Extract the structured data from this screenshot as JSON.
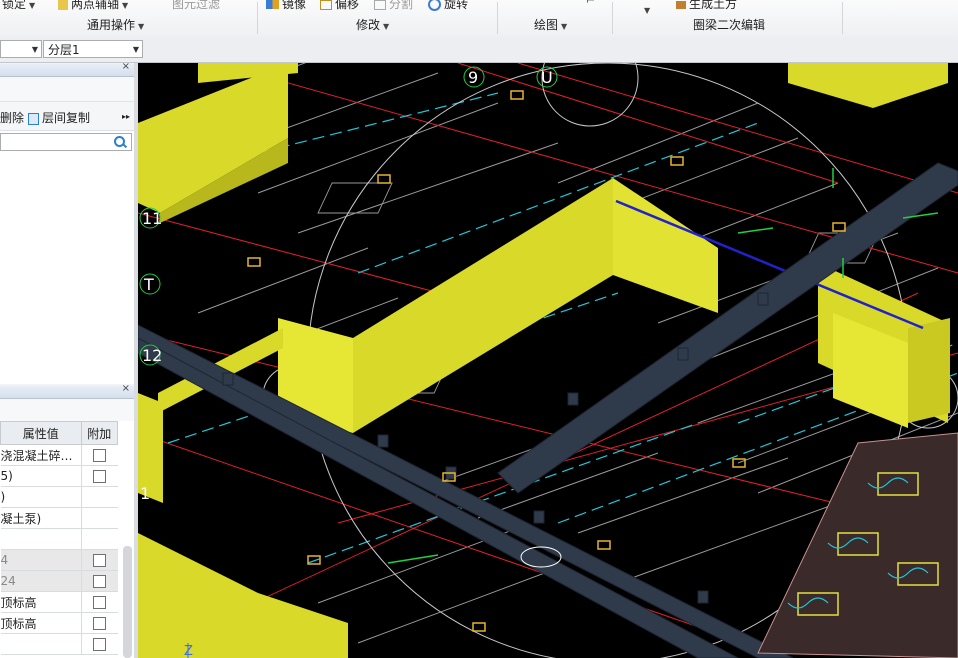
{
  "ribbon": {
    "items": [
      {
        "label": "锁定",
        "dim": false,
        "dropdown": true
      },
      {
        "label": "两点辅轴",
        "dim": false,
        "dropdown": true
      },
      {
        "label": "图元过滤",
        "dim": true,
        "dropdown": false
      },
      {
        "label": "镜像",
        "dim": false,
        "dropdown": false
      },
      {
        "label": "偏移",
        "dim": false,
        "dropdown": false
      },
      {
        "label": "分割",
        "dim": true,
        "dropdown": false
      },
      {
        "label": "旋转",
        "dim": false,
        "dropdown": false
      },
      {
        "label": "生成土方",
        "dim": false,
        "dropdown": false
      }
    ],
    "groups": [
      {
        "label": "通用操作",
        "dropdown": true
      },
      {
        "label": "修改",
        "dropdown": true
      },
      {
        "label": "绘图",
        "dropdown": true
      },
      {
        "label": "圈梁二次编辑",
        "dropdown": false
      }
    ]
  },
  "layerbar": {
    "layer_combo": "分层1"
  },
  "panel_top": {
    "buttons": {
      "delete": "删除",
      "copy_layer": "层间复制"
    },
    "more": "▸▸"
  },
  "props": {
    "headers": [
      "属性值",
      "附加"
    ],
    "rows": [
      {
        "value": "浇混凝土碎…",
        "checkbox": true,
        "grey": false
      },
      {
        "value": "5)",
        "checkbox": true,
        "grey": false
      },
      {
        "value": ")",
        "checkbox": false,
        "grey": false
      },
      {
        "value": "凝土泵)",
        "checkbox": false,
        "grey": false
      },
      {
        "value": "",
        "checkbox": false,
        "grey": false
      },
      {
        "value": "4",
        "checkbox": true,
        "grey": true
      },
      {
        "value": "24",
        "checkbox": true,
        "grey": true
      },
      {
        "value": "顶标高",
        "checkbox": true,
        "grey": false
      },
      {
        "value": "顶标高",
        "checkbox": true,
        "grey": false
      },
      {
        "value": "",
        "checkbox": true,
        "grey": false
      }
    ]
  },
  "canvas": {
    "axis_labels": [
      "9",
      "U",
      "11",
      "T",
      "12",
      "1"
    ],
    "z_label": "Z",
    "colors": {
      "background": "#000000",
      "wall": "#d9d92a",
      "beam": "#2f3a4a",
      "axis_red": "#e0202a",
      "axis_cyan": "#20c8d8",
      "outline": "#c8c8c8"
    }
  }
}
